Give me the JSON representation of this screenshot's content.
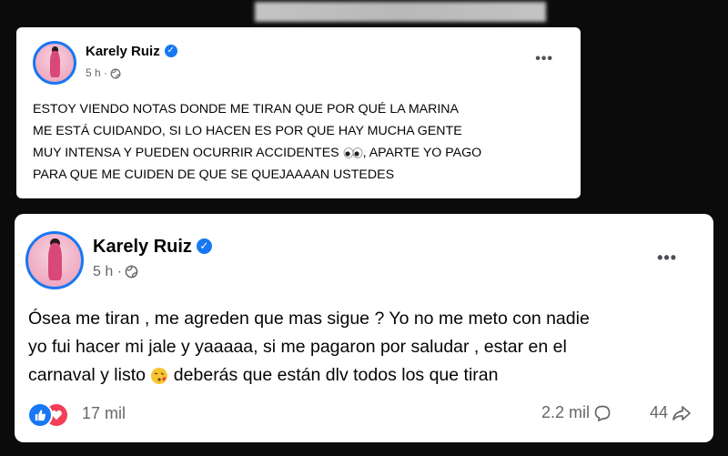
{
  "post1": {
    "author": "Karely Ruiz",
    "time": "5 h ·",
    "text": "ESTOY VIENDO NOTAS DONDE ME TIRAN QUE POR QUÉ LA MARINA\nME ESTÁ CUIDANDO, SI LO HACEN ES POR QUE HAY MUCHA GENTE\nMUY INTENSA Y PUEDEN OCURRIR ACCIDENTES",
    "text_after_emoji": ", APARTE YO PAGO\nPARA QUE ME CUIDEN DE QUE SE QUEJAAAAN USTEDES",
    "more": "•••"
  },
  "post2": {
    "author": "Karely Ruiz",
    "time": "5 h ·",
    "text": "Ósea me tiran , me agreden que mas sigue ? Yo no me meto con nadie\nyo fui hacer mi jale y yaaaaa, si me pagaron por saludar , estar en el\ncarnaval y listo",
    "text_after_emoji": " deberás que están dlv todos los que tiran",
    "more": "•••",
    "reactions_count": "17 mil",
    "comments_count": "2.2 mil",
    "shares_count": "44"
  },
  "icons": {
    "verified": "verified-badge-icon",
    "globe": "globe-icon",
    "like": "like-reaction-icon",
    "love": "love-reaction-icon",
    "comment": "comment-icon",
    "share": "share-icon",
    "eyes": "eyes-emoji",
    "kiss": "face-blowing-kiss-emoji"
  },
  "colors": {
    "accent": "#1877f2",
    "love": "#f33e58",
    "text": "#050505",
    "muted": "#65676b",
    "background": "#0b0b0b"
  }
}
